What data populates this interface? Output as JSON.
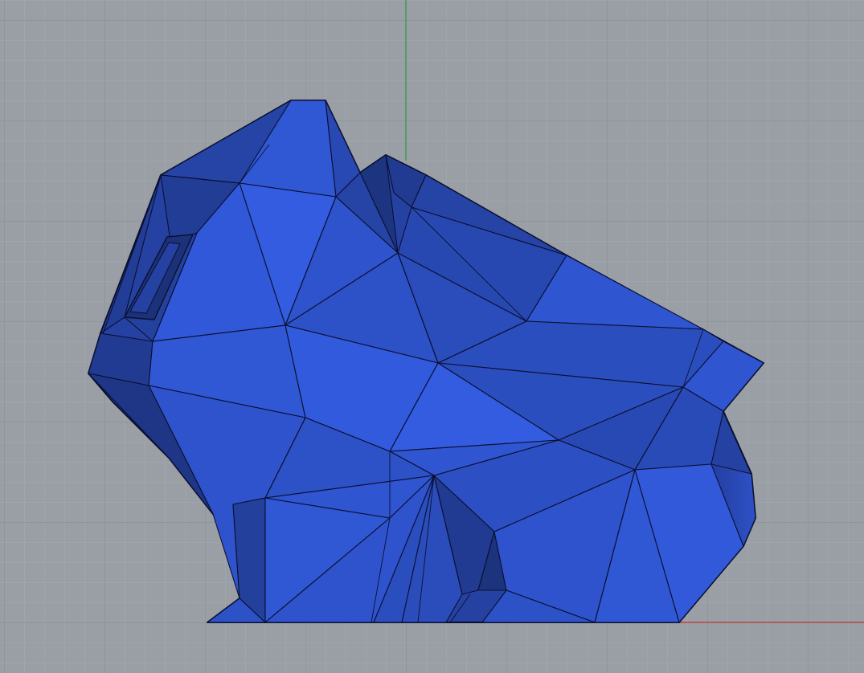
{
  "viewport": {
    "view": "Front",
    "display_mode": "shaded",
    "background_color": "#9a9ea5",
    "grid": {
      "visible": true,
      "minor_color": "#a7abb2",
      "major_color": "#8d9198"
    },
    "axes": {
      "x_axis_color": "#c0392b",
      "y_axis_color": "#2e9d3a"
    },
    "mesh": {
      "name": "low-poly-rabbit",
      "fill_color": "#2f55d0",
      "edge_color": "#0b1030"
    }
  }
}
